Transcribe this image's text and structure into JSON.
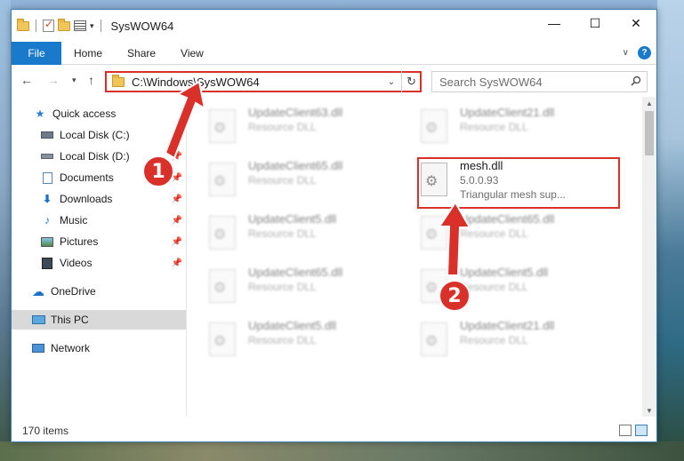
{
  "window": {
    "title": "SysWOW64",
    "controls": {
      "minimize": "—",
      "maximize": "☐",
      "close": "✕"
    }
  },
  "ribbon": {
    "tabs": [
      "File",
      "Home",
      "Share",
      "View"
    ],
    "help": "?"
  },
  "address": {
    "path": "C:\\Windows\\SysWOW64",
    "search_placeholder": "Search SysWOW64"
  },
  "sidebar": {
    "items": [
      {
        "label": "Quick access",
        "icon": "star-icon",
        "pinned": false
      },
      {
        "label": "Local Disk (C:)",
        "icon": "drive-icon",
        "pinned": false
      },
      {
        "label": "Local Disk (D:)",
        "icon": "drive-icon",
        "pinned": true
      },
      {
        "label": "Documents",
        "icon": "document-icon",
        "pinned": true
      },
      {
        "label": "Downloads",
        "icon": "download-icon",
        "pinned": true
      },
      {
        "label": "Music",
        "icon": "music-icon",
        "pinned": true
      },
      {
        "label": "Pictures",
        "icon": "pictures-icon",
        "pinned": true
      },
      {
        "label": "Videos",
        "icon": "videos-icon",
        "pinned": true
      },
      {
        "label": "OneDrive",
        "icon": "cloud-icon",
        "pinned": false
      },
      {
        "label": "This PC",
        "icon": "computer-icon",
        "pinned": false,
        "selected": true
      },
      {
        "label": "Network",
        "icon": "network-icon",
        "pinned": false
      }
    ]
  },
  "files": {
    "left": [
      {
        "name": "UpdateClient63.dll",
        "sub": "Resource DLL"
      },
      {
        "name": "UpdateClient65.dll",
        "sub": "Resource DLL"
      },
      {
        "name": "UpdateClient5.dll",
        "sub": "Resource DLL"
      },
      {
        "name": "UpdateClient65.dll",
        "sub": "Resource DLL"
      },
      {
        "name": "UpdateClient5.dll",
        "sub": "Resource DLL"
      }
    ],
    "right": [
      {
        "name": "UpdateClient21.dll",
        "sub": "Resource DLL"
      },
      {
        "name": "mesh.dll",
        "version": "5.0.0.93",
        "sub": "Triangular mesh sup..."
      },
      {
        "name": "UpdateClient65.dll",
        "sub": "Resource DLL"
      },
      {
        "name": "UpdateClient5.dll",
        "sub": "Resource DLL"
      },
      {
        "name": "UpdateClient21.dll",
        "sub": "Resource DLL"
      }
    ]
  },
  "status": {
    "item_count": "170 items"
  },
  "annotations": {
    "step1": "1",
    "step2": "2",
    "color": "#d9302a"
  }
}
